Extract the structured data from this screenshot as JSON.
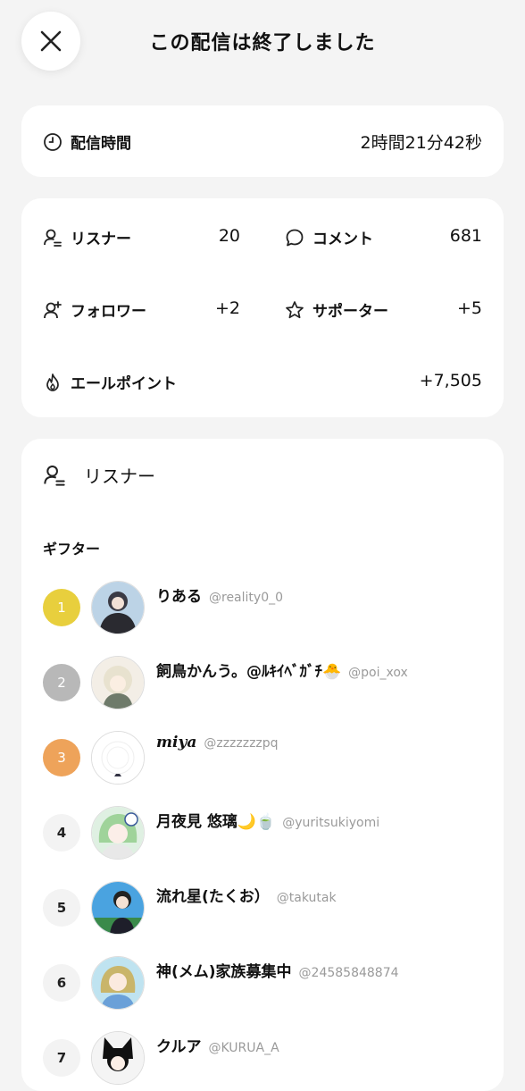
{
  "header": {
    "title": "この配信は終了しました"
  },
  "duration": {
    "label": "配信時間",
    "value": "2時間21分42秒"
  },
  "stats": {
    "listeners": {
      "label": "リスナー",
      "value": "20"
    },
    "comments": {
      "label": "コメント",
      "value": "681"
    },
    "followers": {
      "label": "フォロワー",
      "value": "+2"
    },
    "supporters": {
      "label": "サポーター",
      "value": "+5"
    },
    "yell_points": {
      "label": "エールポイント",
      "value": "+7,505"
    }
  },
  "listeners_section": {
    "title": "リスナー",
    "gifter_title": "ギフター",
    "gifters": [
      {
        "rank": "1",
        "name": "りある",
        "handle": "@reality0_0"
      },
      {
        "rank": "2",
        "name": "飼鳥かんう。@ﾙｷｲﾍﾞｶﾞﾁ🐣",
        "handle": "@poi_xox"
      },
      {
        "rank": "3",
        "name": "miya",
        "handle": "@zzzzzzzpq"
      },
      {
        "rank": "4",
        "name": "月夜見 悠璃🌙🍵",
        "handle": "@yuritsukiyomi"
      },
      {
        "rank": "5",
        "name": "流れ星(たくお）",
        "handle": "@takutak"
      },
      {
        "rank": "6",
        "name": "神(メム)家族募集中",
        "handle": "@24585848874"
      },
      {
        "rank": "7",
        "name": "クルア",
        "handle": "@KURUA_A"
      }
    ]
  },
  "colors": {
    "gold": "#e8cf3d",
    "silver": "#b8b8b8",
    "bronze": "#eea35a"
  }
}
